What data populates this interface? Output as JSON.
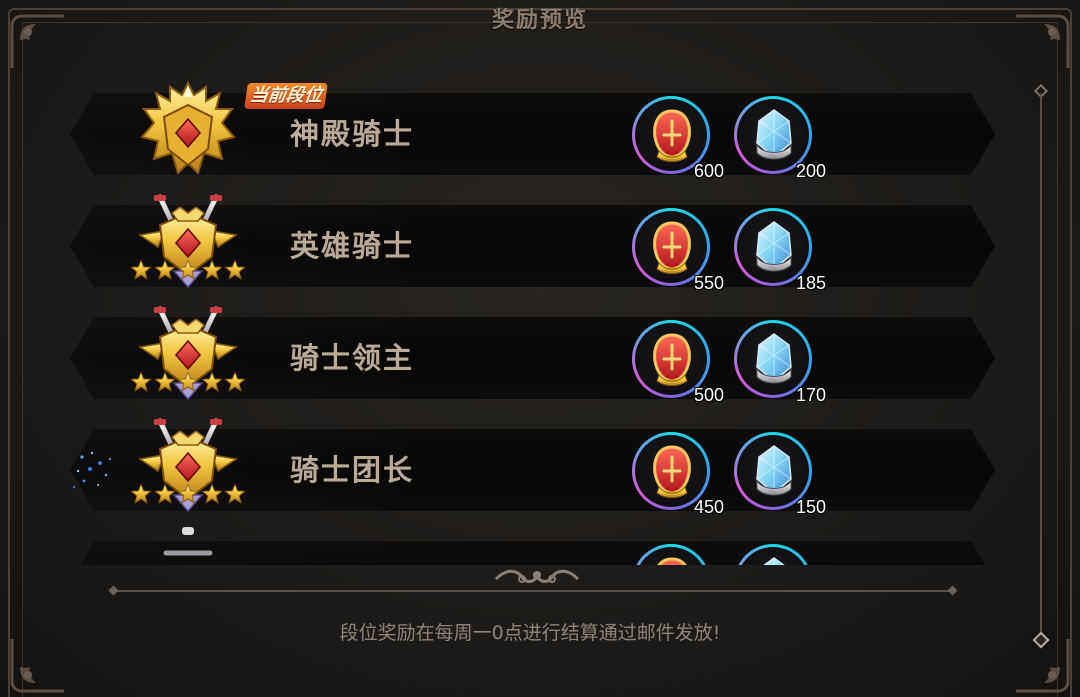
{
  "panel": {
    "title": "奖励预览",
    "footer_note": "段位奖励在每周一0点进行结算通过邮件发放!"
  },
  "current_badge": "当前段位",
  "colors": {
    "rank_name": "#b9ab95",
    "badge_bg": "#e0661f",
    "ring_cyan": "#1fd7e8",
    "ring_purple": "#d45ad8",
    "footer_text": "#8f8479"
  },
  "ranks": [
    {
      "name": "神殿骑士",
      "current": true,
      "emblem": "golden-shield-crown-emblem-icon",
      "stars": 0,
      "rewards": [
        {
          "item": "red-gold-badge-icon",
          "qty": "600"
        },
        {
          "item": "blue-crystal-shard-icon",
          "qty": "200"
        }
      ]
    },
    {
      "name": "英雄骑士",
      "current": false,
      "emblem": "winged-crossed-swords-emblem-icon",
      "stars": 5,
      "rewards": [
        {
          "item": "red-gold-badge-icon",
          "qty": "550"
        },
        {
          "item": "blue-crystal-shard-icon",
          "qty": "185"
        }
      ]
    },
    {
      "name": "骑士领主",
      "current": false,
      "emblem": "crossed-swords-shield-emblem-icon",
      "stars": 5,
      "rewards": [
        {
          "item": "red-gold-badge-icon",
          "qty": "500"
        },
        {
          "item": "blue-crystal-shard-icon",
          "qty": "170"
        }
      ]
    },
    {
      "name": "骑士团长",
      "current": false,
      "emblem": "crossed-swords-shield-emblem-icon",
      "stars": 5,
      "rewards": [
        {
          "item": "red-gold-badge-icon",
          "qty": "450"
        },
        {
          "item": "blue-crystal-shard-icon",
          "qty": "150"
        }
      ]
    },
    {
      "name": "",
      "current": false,
      "emblem": "silver-sword-emblem-icon",
      "stars": 0,
      "rewards": [
        {
          "item": "red-gold-badge-icon",
          "qty": ""
        },
        {
          "item": "blue-crystal-shard-icon",
          "qty": ""
        }
      ]
    }
  ]
}
